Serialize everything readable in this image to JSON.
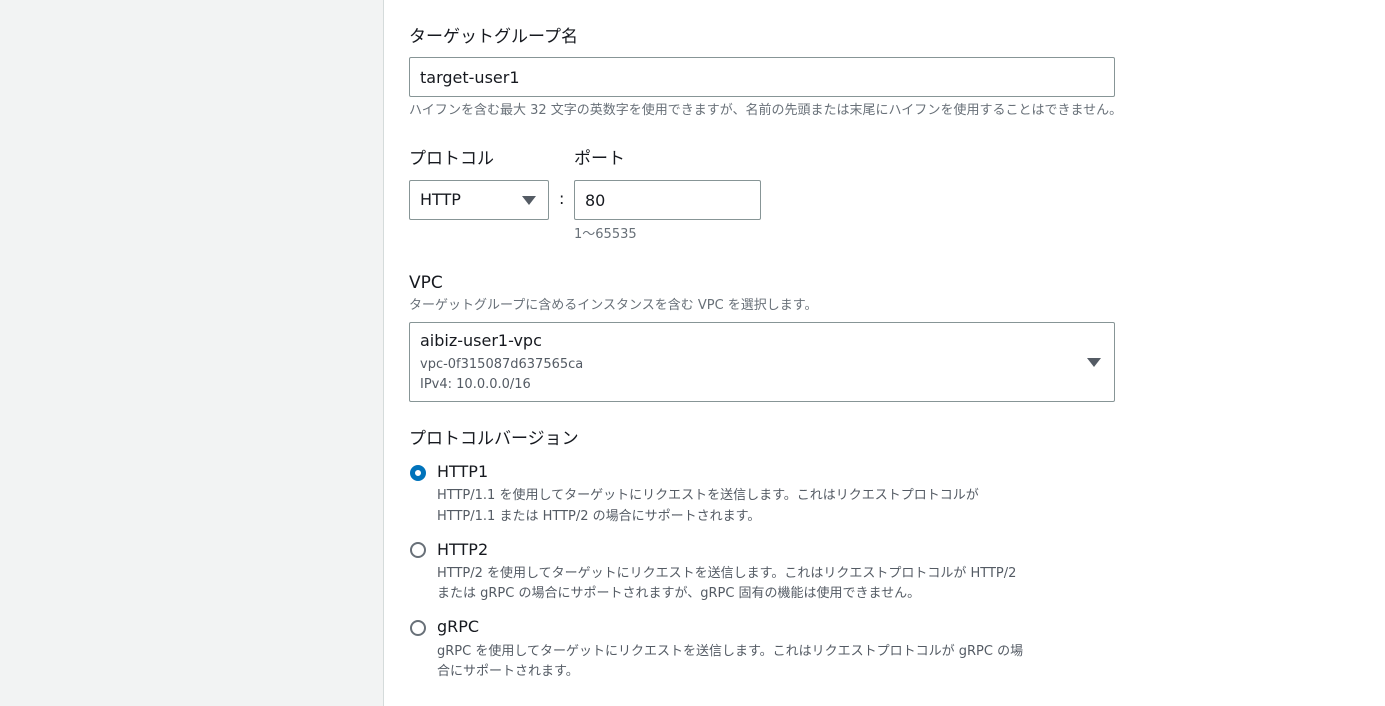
{
  "target_group": {
    "name_label": "ターゲットグループ名",
    "name_value": "target-user1",
    "name_hint": "ハイフンを含む最大 32 文字の英数字を使用できますが、名前の先頭または末尾にハイフンを使用することはできません。"
  },
  "protocol": {
    "label": "プロトコル",
    "selected": "HTTP",
    "separator": ":"
  },
  "port": {
    "label": "ポート",
    "value": "80",
    "hint": "1〜65535"
  },
  "vpc": {
    "label": "VPC",
    "hint": "ターゲットグループに含めるインスタンスを含む VPC を選択します。",
    "selected_name": "aibiz-user1-vpc",
    "selected_id": "vpc-0f315087d637565ca",
    "selected_cidr": "IPv4: 10.0.0.0/16"
  },
  "protocol_version": {
    "label": "プロトコルバージョン",
    "options": [
      {
        "title": "HTTP1",
        "desc_line1": "HTTP/1.1 を使用してターゲットにリクエストを送信します。これはリクエストプロトコルが",
        "desc_line2": "HTTP/1.1 または HTTP/2 の場合にサポートされます。",
        "checked": true
      },
      {
        "title": "HTTP2",
        "desc_line1": "HTTP/2 を使用してターゲットにリクエストを送信します。これはリクエストプロトコルが HTTP/2",
        "desc_line2": "または gRPC の場合にサポートされますが、gRPC 固有の機能は使用できません。",
        "checked": false
      },
      {
        "title": "gRPC",
        "desc_line1": "gRPC を使用してターゲットにリクエストを送信します。これはリクエストプロトコルが gRPC の場",
        "desc_line2": "合にサポートされます。",
        "checked": false
      }
    ]
  },
  "colors": {
    "accent": "#0073bb",
    "border": "#879596",
    "hint_text": "#687078",
    "background_gutter": "#f2f3f3"
  }
}
